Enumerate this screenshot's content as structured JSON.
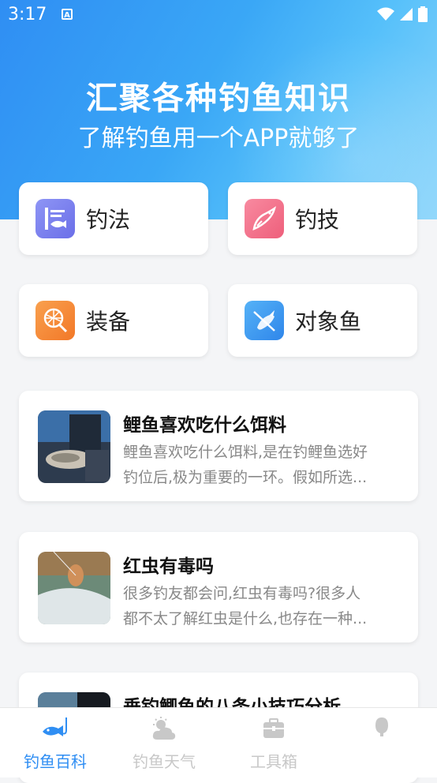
{
  "status_bar": {
    "time": "3:17",
    "badge": "A"
  },
  "hero": {
    "title": "汇聚各种钓鱼知识",
    "subtitle": "了解钓鱼用一个APP就够了"
  },
  "categories": [
    {
      "label": "钓法",
      "icon": "fishing-method-icon",
      "color": "#7b7ff0"
    },
    {
      "label": "钓技",
      "icon": "fishing-skill-icon",
      "color": "#f06e86"
    },
    {
      "label": "装备",
      "icon": "fishing-net-icon",
      "color": "#f58a3b"
    },
    {
      "label": "对象鱼",
      "icon": "target-fish-icon",
      "color": "#3496f0"
    }
  ],
  "articles": [
    {
      "title": "鲤鱼喜欢吃什么饵料",
      "desc_line1": "鲤鱼喜欢吃什么饵料,是在钓鲤鱼选好",
      "desc_line2": "钓位后,极为重要的一环。假如所选..."
    },
    {
      "title": "红虫有毒吗",
      "desc_line1": "很多钓友都会问,红虫有毒吗?很多人",
      "desc_line2": "都不太了解红虫是什么,也存在一种..."
    },
    {
      "title": "垂钓鲫鱼的八条小技巧分析",
      "desc_line1": "",
      "desc_line2": ""
    }
  ],
  "tabs": [
    {
      "label": "钓鱼百科",
      "icon": "fish-hook-icon",
      "active": true
    },
    {
      "label": "钓鱼天气",
      "icon": "weather-icon",
      "active": false
    },
    {
      "label": "工具箱",
      "icon": "toolbox-icon",
      "active": false
    },
    {
      "label": "",
      "icon": "profile-icon",
      "active": false
    }
  ],
  "colors": {
    "accent": "#2f8ef3",
    "inactive_tab": "#c8c8c8"
  }
}
